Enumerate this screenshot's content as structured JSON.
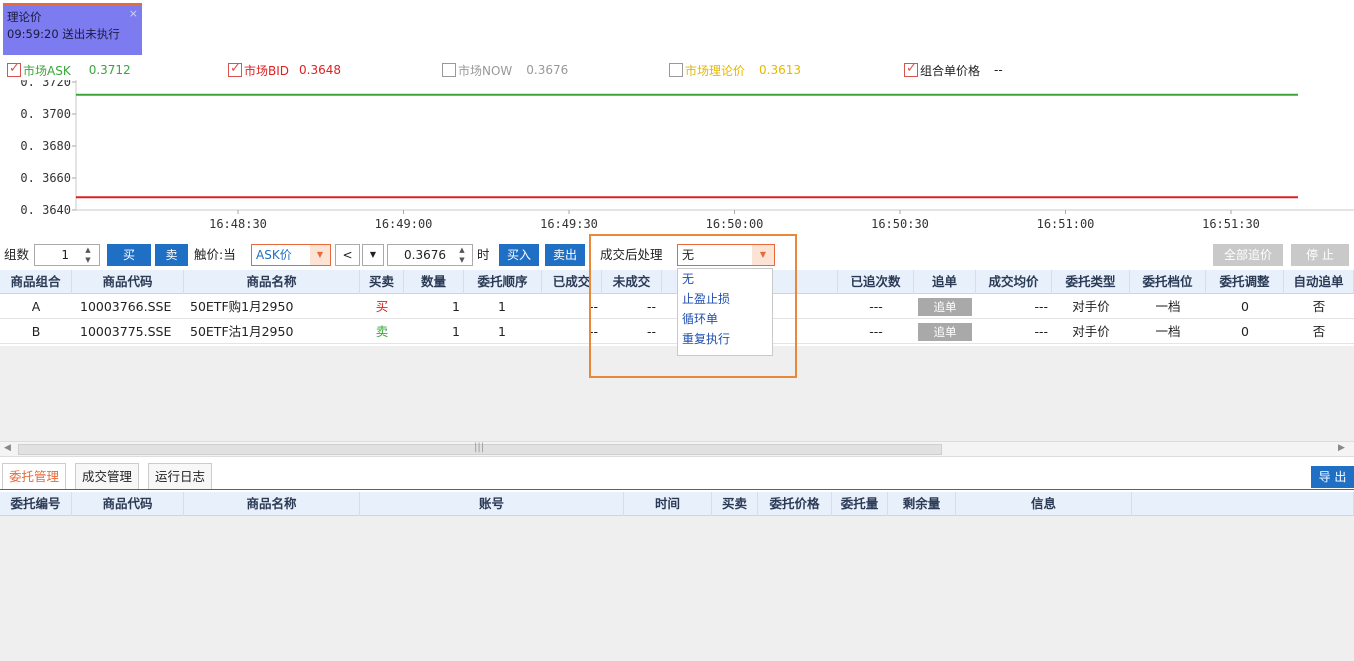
{
  "notice": {
    "title": "理论价",
    "message": "09:59:20 送出未执行",
    "close": "×"
  },
  "legend": [
    {
      "label": "市场ASK",
      "value": "0.3712",
      "checked": true,
      "color": "#3aa63a"
    },
    {
      "label": "市场BID",
      "value": "0.3648",
      "checked": true,
      "color": "#e02020"
    },
    {
      "label": "市场NOW",
      "value": "0.3676",
      "checked": false,
      "color": "#999999"
    },
    {
      "label": "市场理论价",
      "value": "0.3613",
      "checked": false,
      "color": "#e6b800"
    },
    {
      "label": "组合单价格",
      "value": "--",
      "checked": true,
      "color": "#222222"
    }
  ],
  "chart_data": {
    "type": "line",
    "y_ticks": [
      "0.3720",
      "0.3700",
      "0.3680",
      "0.3660",
      "0.3640"
    ],
    "x_ticks": [
      "16:48:30",
      "16:49:00",
      "16:49:30",
      "16:50:00",
      "16:50:30",
      "16:51:00",
      "16:51:30"
    ],
    "ylim": [
      0.364,
      0.372
    ],
    "series": [
      {
        "name": "市场ASK",
        "value": 0.3712,
        "color": "#3aa63a"
      },
      {
        "name": "市场BID",
        "value": 0.3648,
        "color": "#e02020"
      }
    ]
  },
  "toolbar": {
    "group_label": "组数",
    "group_count": "1",
    "buy": "买",
    "sell": "卖",
    "trigger_label": "触价:当",
    "trigger_price_type": "ASK价",
    "compare": "<",
    "price": "0.3676",
    "time_label": "时",
    "buy_in": "买入",
    "sell_out": "卖出",
    "after_fill_label": "成交后处理",
    "after_fill_value": "无",
    "chase_all": "全部追价",
    "stop": "停 止"
  },
  "after_fill_options": [
    "无",
    "止盈止损",
    "循环单",
    "重复执行"
  ],
  "upper_table": {
    "headers": [
      "商品组合",
      "商品代码",
      "商品名称",
      "买卖",
      "数量",
      "委托顺序",
      "已成交",
      "未成交",
      "已追次数",
      "追单",
      "成交均价",
      "委托类型",
      "委托档位",
      "委托调整",
      "自动追单"
    ],
    "rows": [
      {
        "combo": "A",
        "code": "10003766.SSE",
        "name": "50ETF购1月2950",
        "side": "买",
        "qty": "1",
        "order": "1",
        "filled": "--",
        "unfilled": "--",
        "chased": "---",
        "chase_btn": "追单",
        "avg": "---",
        "type": "对手价",
        "level": "一档",
        "adjust": "0",
        "auto": "否"
      },
      {
        "combo": "B",
        "code": "10003775.SSE",
        "name": "50ETF沽1月2950",
        "side": "卖",
        "qty": "1",
        "order": "1",
        "filled": "--",
        "unfilled": "--",
        "chased": "---",
        "chase_btn": "追单",
        "avg": "---",
        "type": "对手价",
        "level": "一档",
        "adjust": "0",
        "auto": "否"
      }
    ]
  },
  "tabs": [
    "委托管理",
    "成交管理",
    "运行日志"
  ],
  "export_label": "导 出",
  "lower_table": {
    "headers": [
      "委托编号",
      "商品代码",
      "商品名称",
      "账号",
      "时间",
      "买卖",
      "委托价格",
      "委托量",
      "剩余量",
      "信息"
    ]
  }
}
